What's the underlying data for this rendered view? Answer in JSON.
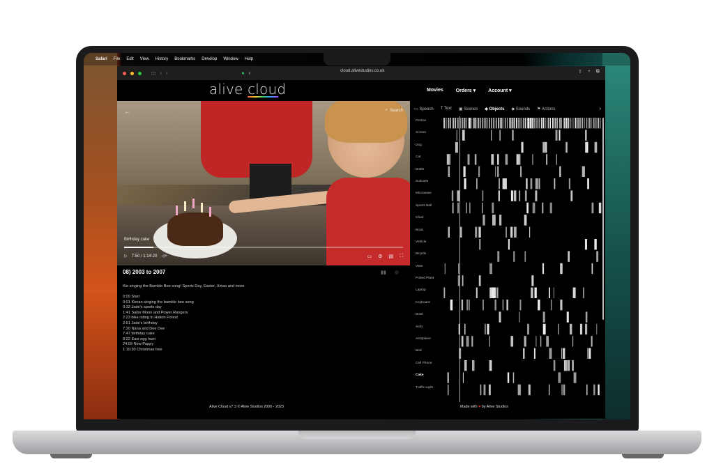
{
  "menubar": {
    "app": "Safari",
    "items": [
      "File",
      "Edit",
      "View",
      "History",
      "Bookmarks",
      "Develop",
      "Window",
      "Help"
    ]
  },
  "browser": {
    "url": "cloud.alivestudios.co.uk"
  },
  "header": {
    "logo": "alive cloud",
    "nav": [
      "Movies",
      "Orders ▾",
      "Account ▾"
    ]
  },
  "video": {
    "search_label": "Search",
    "chapter_label": "Birthday cake",
    "time": "7:50 / 1:14:20",
    "progress": 0.105
  },
  "details": {
    "title": "08) 2003 to 2007",
    "description": "Kie singing the Bumble Bee song! Sports Day, Easter, Xmas and more",
    "timestamps": [
      "0:00 Start",
      "0:01 Kieran singing the bumble bee song",
      "0:33 Jade's sports day",
      "1:41 Sailor Moon and Power Rangers",
      "2:23 bike riding in Halton Forest",
      "2:51 Jade's birthday",
      "7:20 Nana and Dee Dee",
      "7:47 birthday cake",
      "8:22 East egg hunt",
      "24:09 New Puppy",
      "1:10:30 Christmas tree"
    ]
  },
  "panel": {
    "tabs": [
      "Speech",
      "Text",
      "Scenes",
      "Objects",
      "Sounds",
      "Actions"
    ],
    "active_tab": "Objects",
    "labels": [
      "Person",
      "Screen",
      "Dog",
      "Cat",
      "Bottle",
      "Suitcase",
      "Microwave",
      "Sports Ball",
      "Chair",
      "Book",
      "Vehicle",
      "Bicycle",
      "Vase",
      "Potted Plant",
      "Laptop",
      "Keyboard",
      "Bowl",
      "Sofa",
      "Aeroplane",
      "Bed",
      "Cell Phone",
      "Cake",
      "Traffic Light"
    ],
    "selected_label": "Cake"
  },
  "footer": {
    "left": "Alive Cloud v7.3 © Alive Studios 2000 - 2023",
    "right_prefix": "Made with",
    "right_suffix": "by Alive Studios"
  },
  "colors": {
    "accent": "#ffffff",
    "background": "#000000",
    "heart": "#e22222"
  }
}
